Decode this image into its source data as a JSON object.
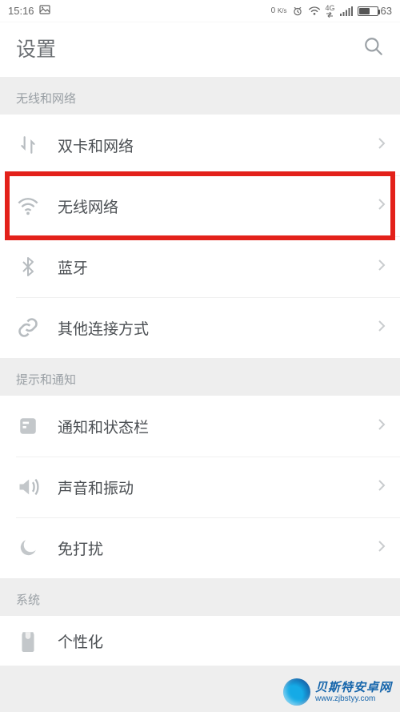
{
  "status": {
    "time": "15:16",
    "net_speed": "0",
    "net_speed_unit": "K/s",
    "battery": "63",
    "net_gen": "4G"
  },
  "header": {
    "title": "设置"
  },
  "sections": {
    "wireless_label": "无线和网络",
    "notify_label": "提示和通知",
    "system_label": "系统"
  },
  "items": {
    "dual_sim": "双卡和网络",
    "wlan": "无线网络",
    "bluetooth": "蓝牙",
    "other_conn": "其他连接方式",
    "notif_status": "通知和状态栏",
    "sound_vib": "声音和振动",
    "dnd": "免打扰",
    "personalize": "个性化"
  },
  "watermark": {
    "title": "贝斯特安卓网",
    "url": "www.zjbstyy.com"
  }
}
